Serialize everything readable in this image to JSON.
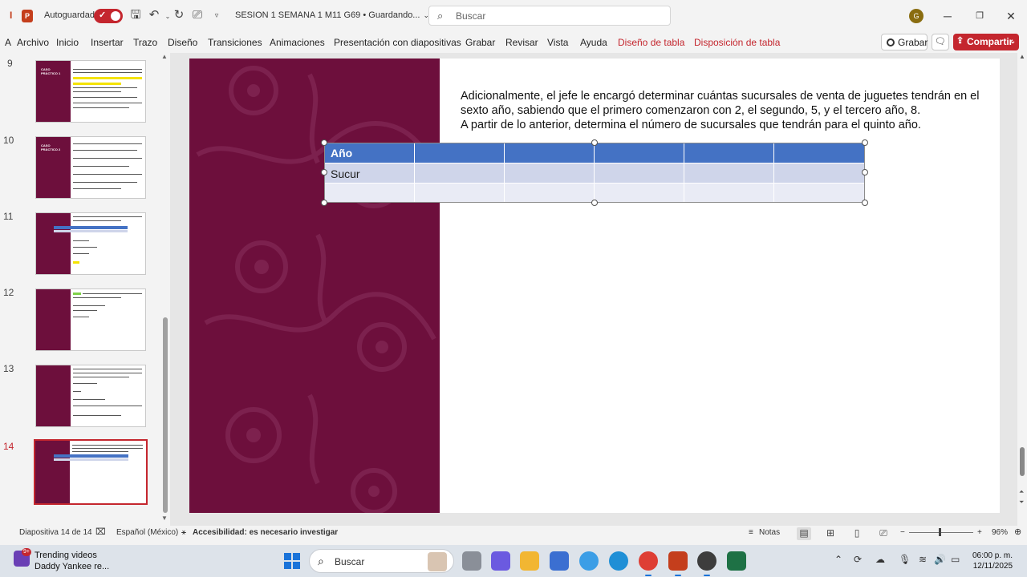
{
  "titlebar": {
    "app_letter": "I",
    "app_logo": "P",
    "autosave_label": "Autoguardado",
    "doc_title": "SESION 1 SEMANA 1 M11 G69 • Guardando...",
    "search_placeholder": "Buscar",
    "user_initial": "G"
  },
  "ribbon": {
    "tabs": [
      "Archivo",
      "Inicio",
      "Insertar",
      "Trazo",
      "Diseño",
      "Transiciones",
      "Animaciones",
      "Presentación con diapositivas",
      "Grabar",
      "Revisar",
      "Vista",
      "Ayuda",
      "Diseño de tabla",
      "Disposición de tabla"
    ],
    "record_label": "Grabar",
    "share_label": "Compartir"
  },
  "thumbnails": [
    {
      "number": "9",
      "title": "CASO PRÁCTICO 1"
    },
    {
      "number": "10",
      "title": "CASO PRÁCTICO 2"
    },
    {
      "number": "11",
      "title": ""
    },
    {
      "number": "12",
      "title": ""
    },
    {
      "number": "13",
      "title": ""
    },
    {
      "number": "14",
      "title": ""
    }
  ],
  "slide": {
    "paragraph_1": "Adicionalmente, el jefe le encargó determinar cuántas sucursales de venta de juguetes tendrán en el sexto año, sabiendo que el primero comenzaron con  2, el segundo, 5, y el tercero año, 8.",
    "paragraph_2": "A partir de lo anterior, determina el número de sucursales que tendrán para el quinto año.",
    "table": {
      "header": "Año",
      "row2_label": "Sucur"
    }
  },
  "statusbar": {
    "slide_count": "Diapositiva 14 de 14",
    "language": "Español (México)",
    "accessibility": "Accesibilidad: es necesario investigar",
    "notes": "Notas",
    "zoom": "96%"
  },
  "taskbar": {
    "news_badge": "9+",
    "news_title": "Trending videos",
    "news_sub": "Daddy Yankee re...",
    "search_placeholder": "Buscar",
    "time": "06:00 p. m.",
    "date": "12/11/2025"
  },
  "colors": {
    "accent": "#c4262e",
    "band": "#6d0f3c",
    "table_header": "#4472c4"
  }
}
